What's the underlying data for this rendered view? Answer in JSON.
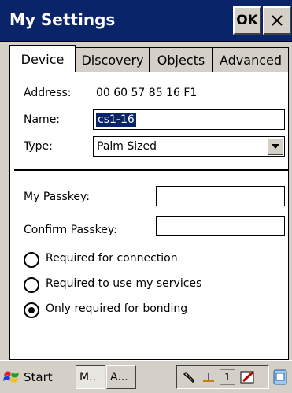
{
  "window": {
    "title": "My Settings",
    "ok_label": "OK"
  },
  "tabs": [
    {
      "label": "Device",
      "active": true
    },
    {
      "label": "Discovery",
      "active": false
    },
    {
      "label": "Objects",
      "active": false
    },
    {
      "label": "Advanced",
      "active": false
    }
  ],
  "device": {
    "address_label": "Address:",
    "address_value": "00 60 57 85 16 F1",
    "name_label": "Name:",
    "name_value": "cs1-16",
    "type_label": "Type:",
    "type_value": "Palm Sized"
  },
  "passkey": {
    "my_label": "My Passkey:",
    "my_value": "",
    "confirm_label": "Confirm Passkey:",
    "confirm_value": ""
  },
  "radios": [
    {
      "label": "Required for connection",
      "selected": false
    },
    {
      "label": "Required to use my services",
      "selected": false
    },
    {
      "label": "Only required for bonding",
      "selected": true
    }
  ],
  "taskbar": {
    "start_label": "Start",
    "task1_label": "M..",
    "task2_label": "A...",
    "tray_number": "1"
  },
  "colors": {
    "titlebar": "#0a246a",
    "face": "#d4d0c8",
    "selection": "#0a246a"
  }
}
